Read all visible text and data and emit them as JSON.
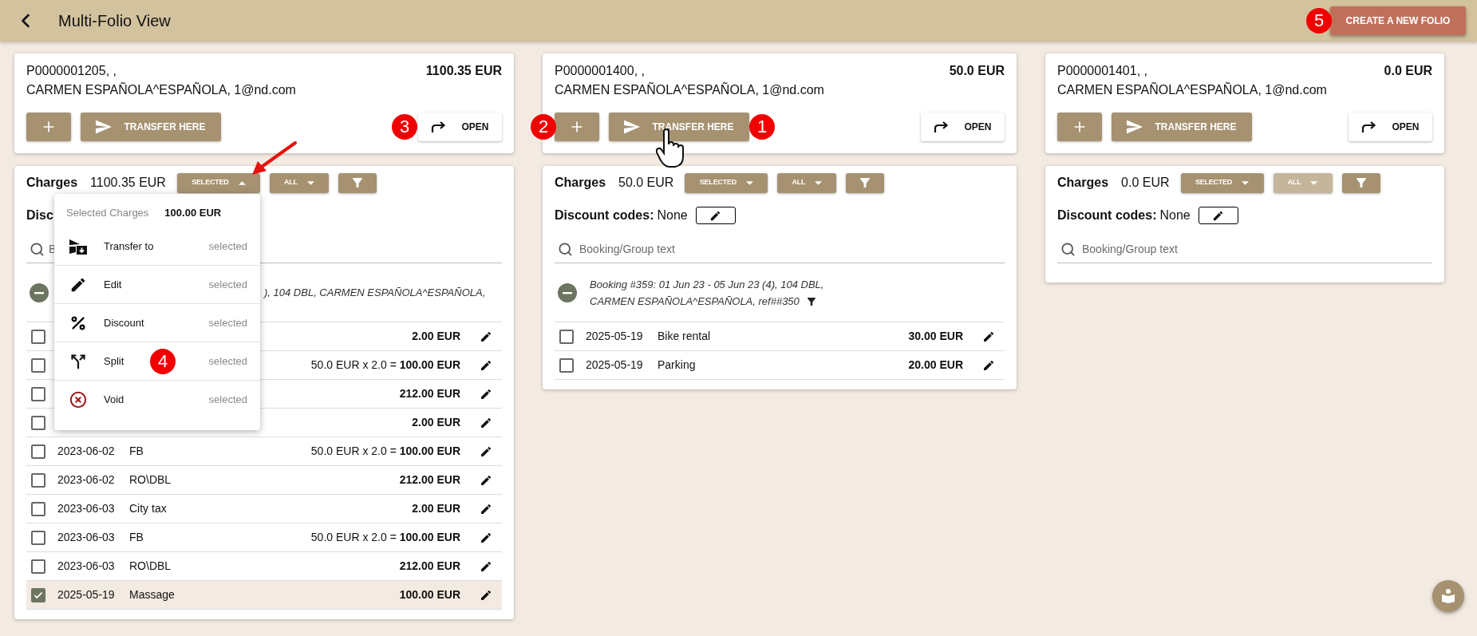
{
  "header": {
    "title": "Multi-Folio View",
    "create_button": "CREATE A NEW FOLIO",
    "create_marker": "5"
  },
  "folios": [
    {
      "number": "P0000001205, ,",
      "total": "1100.35 EUR",
      "guest": "CARMEN ESPAÑOLA^ESPAÑOLA, 1@nd.com",
      "transfer_button": "TRANSFER HERE",
      "open_button": "OPEN",
      "open_marker": "3",
      "charges": {
        "label": "Charges",
        "total": "1100.35 EUR",
        "dropdowns": [
          {
            "label": "SELECTED",
            "expanded": true,
            "disabled": false
          },
          {
            "label": "ALL",
            "expanded": false,
            "disabled": false
          }
        ],
        "discount_label": "Disc",
        "search_placeholder": "B",
        "booking": {
          "text": "), 104 DBL, CARMEN ESPAÑOLA^ESPAÑOLA,",
          "filter": false
        },
        "rows": [
          {
            "amount": "2.00 EUR",
            "checked": false
          },
          {
            "calc": "50.0 EUR x 2.0 =",
            "amount": "100.00 EUR",
            "checked": false
          },
          {
            "amount": "212.00 EUR",
            "checked": false
          },
          {
            "amount": "2.00 EUR",
            "checked": false
          },
          {
            "date": "2023-06-02",
            "description": "FB",
            "calc": "50.0 EUR x 2.0 =",
            "amount": "100.00 EUR",
            "checked": false
          },
          {
            "date": "2023-06-02",
            "description": "RO\\DBL",
            "amount": "212.00 EUR",
            "checked": false
          },
          {
            "date": "2023-06-03",
            "description": "City tax",
            "amount": "2.00 EUR",
            "checked": false
          },
          {
            "date": "2023-06-03",
            "description": "FB",
            "calc": "50.0 EUR x 2.0 =",
            "amount": "100.00 EUR",
            "checked": false
          },
          {
            "date": "2023-06-03",
            "description": "RO\\DBL",
            "amount": "212.00 EUR",
            "checked": false
          },
          {
            "date": "2025-05-19",
            "description": "Massage",
            "amount": "100.00 EUR",
            "checked": true
          }
        ],
        "menu": {
          "title": "Selected Charges",
          "total": "100.00 EUR",
          "items": [
            {
              "kind": "transfer",
              "label": "Transfer to",
              "hint": "selected"
            },
            {
              "kind": "edit",
              "label": "Edit",
              "hint": "selected"
            },
            {
              "kind": "discount",
              "label": "Discount",
              "hint": "selected"
            },
            {
              "kind": "split",
              "label": "Split",
              "hint": "selected",
              "marker": "4"
            },
            {
              "kind": "void",
              "label": "Void",
              "hint": "selected"
            }
          ]
        }
      }
    },
    {
      "number": "P0000001400, ,",
      "total": "50.0 EUR",
      "guest": "CARMEN ESPAÑOLA^ESPAÑOLA, 1@nd.com",
      "transfer_button": "TRANSFER HERE",
      "open_button": "OPEN",
      "add_marker": "2",
      "transfer_marker": "1",
      "charges": {
        "label": "Charges",
        "total": "50.0 EUR",
        "dropdowns": [
          {
            "label": "SELECTED",
            "expanded": false,
            "disabled": false
          },
          {
            "label": "ALL",
            "expanded": false,
            "disabled": false
          }
        ],
        "discount_label": "Discount codes:",
        "discount_value": "None",
        "search_placeholder": "Booking/Group text",
        "booking": {
          "text": "Booking #359: 01 Jun 23 - 05 Jun 23 (4), 104 DBL, CARMEN ESPAÑOLA^ESPAÑOLA, ref##350",
          "filter": true
        },
        "rows": [
          {
            "date": "2025-05-19",
            "description": "Bike rental",
            "amount": "30.00 EUR",
            "checked": false
          },
          {
            "date": "2025-05-19",
            "description": "Parking",
            "amount": "20.00 EUR",
            "checked": false
          }
        ]
      }
    },
    {
      "number": "P0000001401, ,",
      "total": "0.0 EUR",
      "guest": "CARMEN ESPAÑOLA^ESPAÑOLA, 1@nd.com",
      "transfer_button": "TRANSFER HERE",
      "open_button": "OPEN",
      "charges": {
        "label": "Charges",
        "total": "0.0 EUR",
        "dropdowns": [
          {
            "label": "SELECTED",
            "expanded": false,
            "disabled": false
          },
          {
            "label": "ALL",
            "expanded": false,
            "disabled": true
          }
        ],
        "discount_label": "Discount codes:",
        "discount_value": "None",
        "search_placeholder": "Booking/Group text"
      }
    }
  ]
}
